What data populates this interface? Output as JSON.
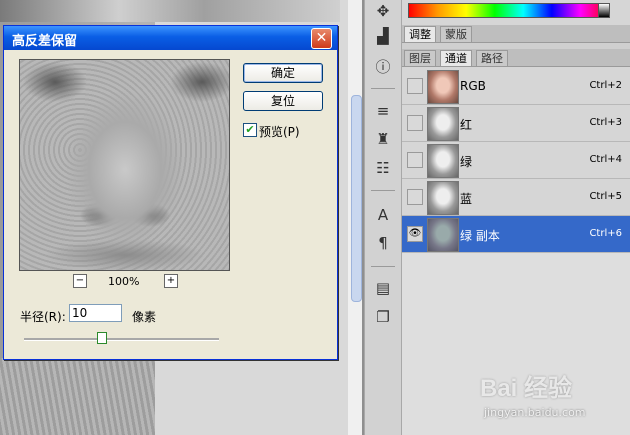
{
  "dialog": {
    "title": "高反差保留",
    "close_glyph": "✕",
    "ok_label": "确定",
    "reset_label": "复位",
    "preview_label": "预览(P)",
    "preview_checked_glyph": "✔",
    "zoom_out_glyph": "−",
    "zoom_in_glyph": "+",
    "zoom_level": "100%",
    "radius_label": "半径(R):",
    "radius_value": "10",
    "radius_unit": "像素",
    "slider_fraction": 0.4
  },
  "panel_tabs_top": [
    "调整",
    "蒙版"
  ],
  "panel_tabs_channel": [
    "图层",
    "通道",
    "路径"
  ],
  "channels": [
    {
      "name": "RGB",
      "shortcut": "Ctrl+2",
      "thumb": "rgb",
      "selected": false,
      "visible_glyph": ""
    },
    {
      "name": "红",
      "shortcut": "Ctrl+3",
      "thumb": "gray",
      "selected": false,
      "visible_glyph": ""
    },
    {
      "name": "绿",
      "shortcut": "Ctrl+4",
      "thumb": "gray",
      "selected": false,
      "visible_glyph": ""
    },
    {
      "name": "蓝",
      "shortcut": "Ctrl+5",
      "thumb": "gray",
      "selected": false,
      "visible_glyph": ""
    },
    {
      "name": "绿 副本",
      "shortcut": "Ctrl+6",
      "thumb": "sel",
      "selected": true,
      "visible_glyph": "👁"
    }
  ],
  "tools": [
    {
      "name": "navigator-icon",
      "glyph": "✥"
    },
    {
      "name": "histogram-icon",
      "glyph": "▟"
    },
    {
      "name": "info-icon",
      "glyph": "ⓘ"
    },
    {
      "name": "brush-presets-icon",
      "glyph": "≡"
    },
    {
      "name": "clone-source-icon",
      "glyph": "♜"
    },
    {
      "name": "tool-presets-icon",
      "glyph": "☷"
    },
    {
      "name": "character-icon",
      "glyph": "A"
    },
    {
      "name": "paragraph-icon",
      "glyph": "¶"
    },
    {
      "name": "notes-icon",
      "glyph": "▤"
    },
    {
      "name": "layer-comps-icon",
      "glyph": "❐"
    }
  ],
  "watermark": {
    "logo": "Bai 经验",
    "url": "jingyan.baidu.com"
  },
  "colors": {
    "title_blue": "#0a5ee5",
    "selection": "#3569c9"
  }
}
